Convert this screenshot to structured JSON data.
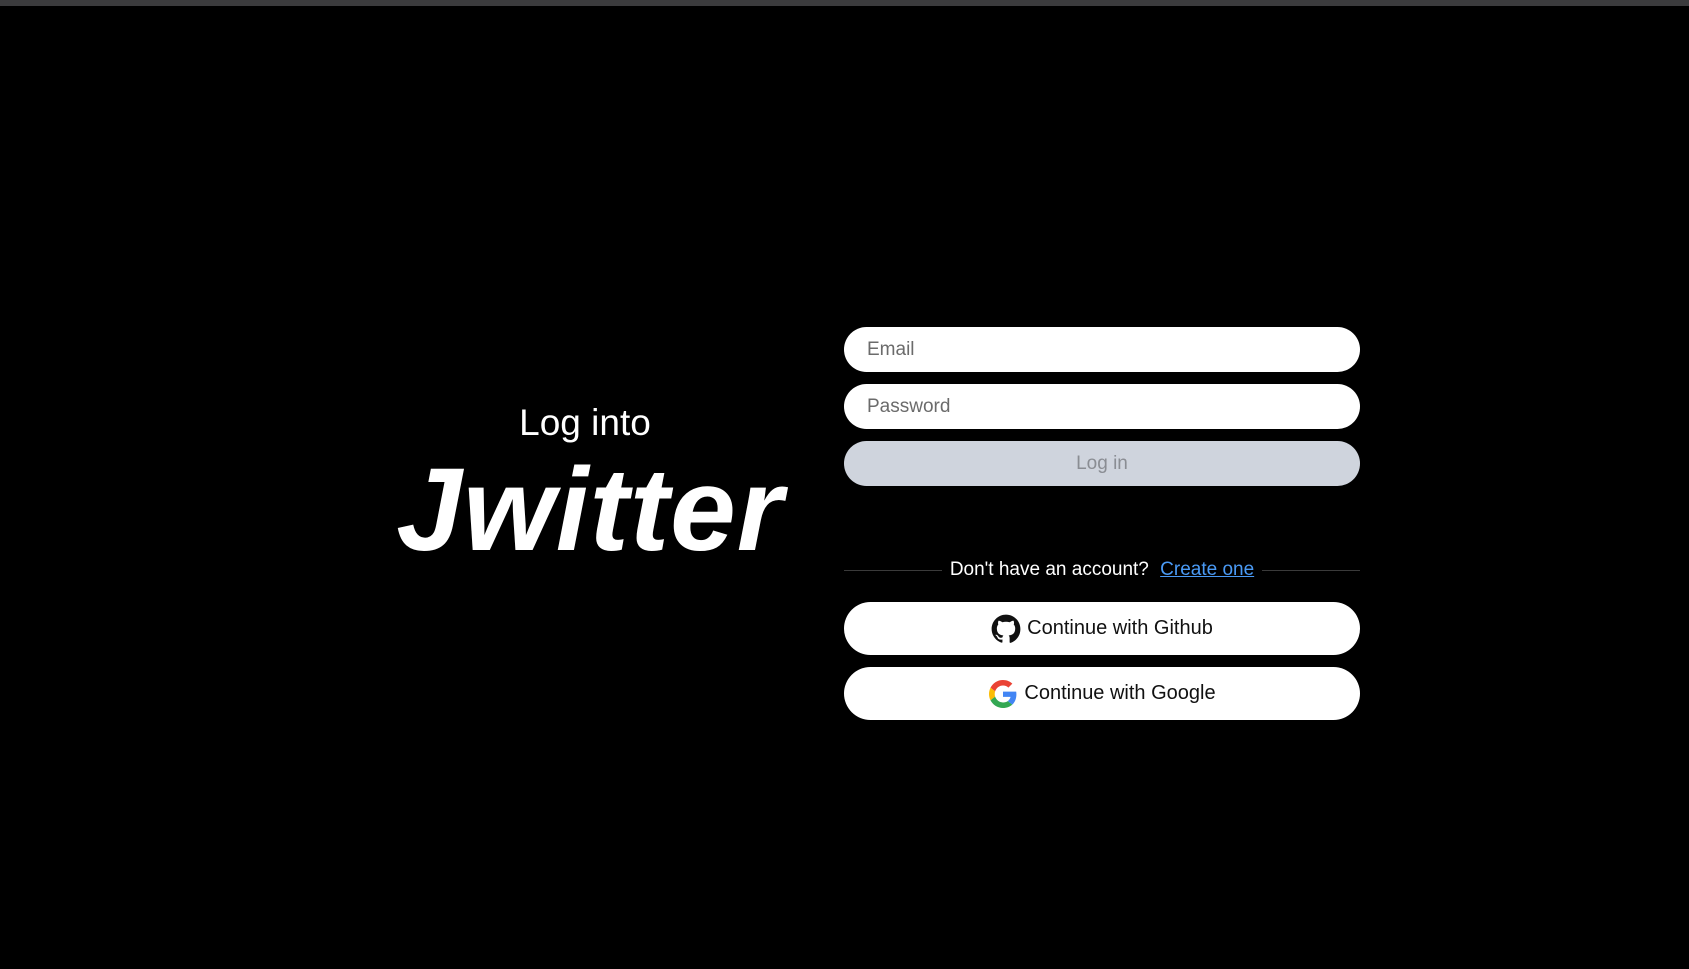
{
  "hero": {
    "subtitle": "Log into",
    "brand": "Jwitter"
  },
  "form": {
    "email_placeholder": "Email",
    "password_placeholder": "Password",
    "login_label": "Log in"
  },
  "signup": {
    "prompt": "Don't have an account?",
    "link_label": "Create one"
  },
  "oauth": {
    "github_label": "Continue with Github",
    "github_icon": "github-icon",
    "google_label": "Continue with Google",
    "google_icon": "google-icon"
  },
  "colors": {
    "background": "#000000",
    "login_button_bg": "#cfd4dd",
    "link": "#4a9af5"
  }
}
